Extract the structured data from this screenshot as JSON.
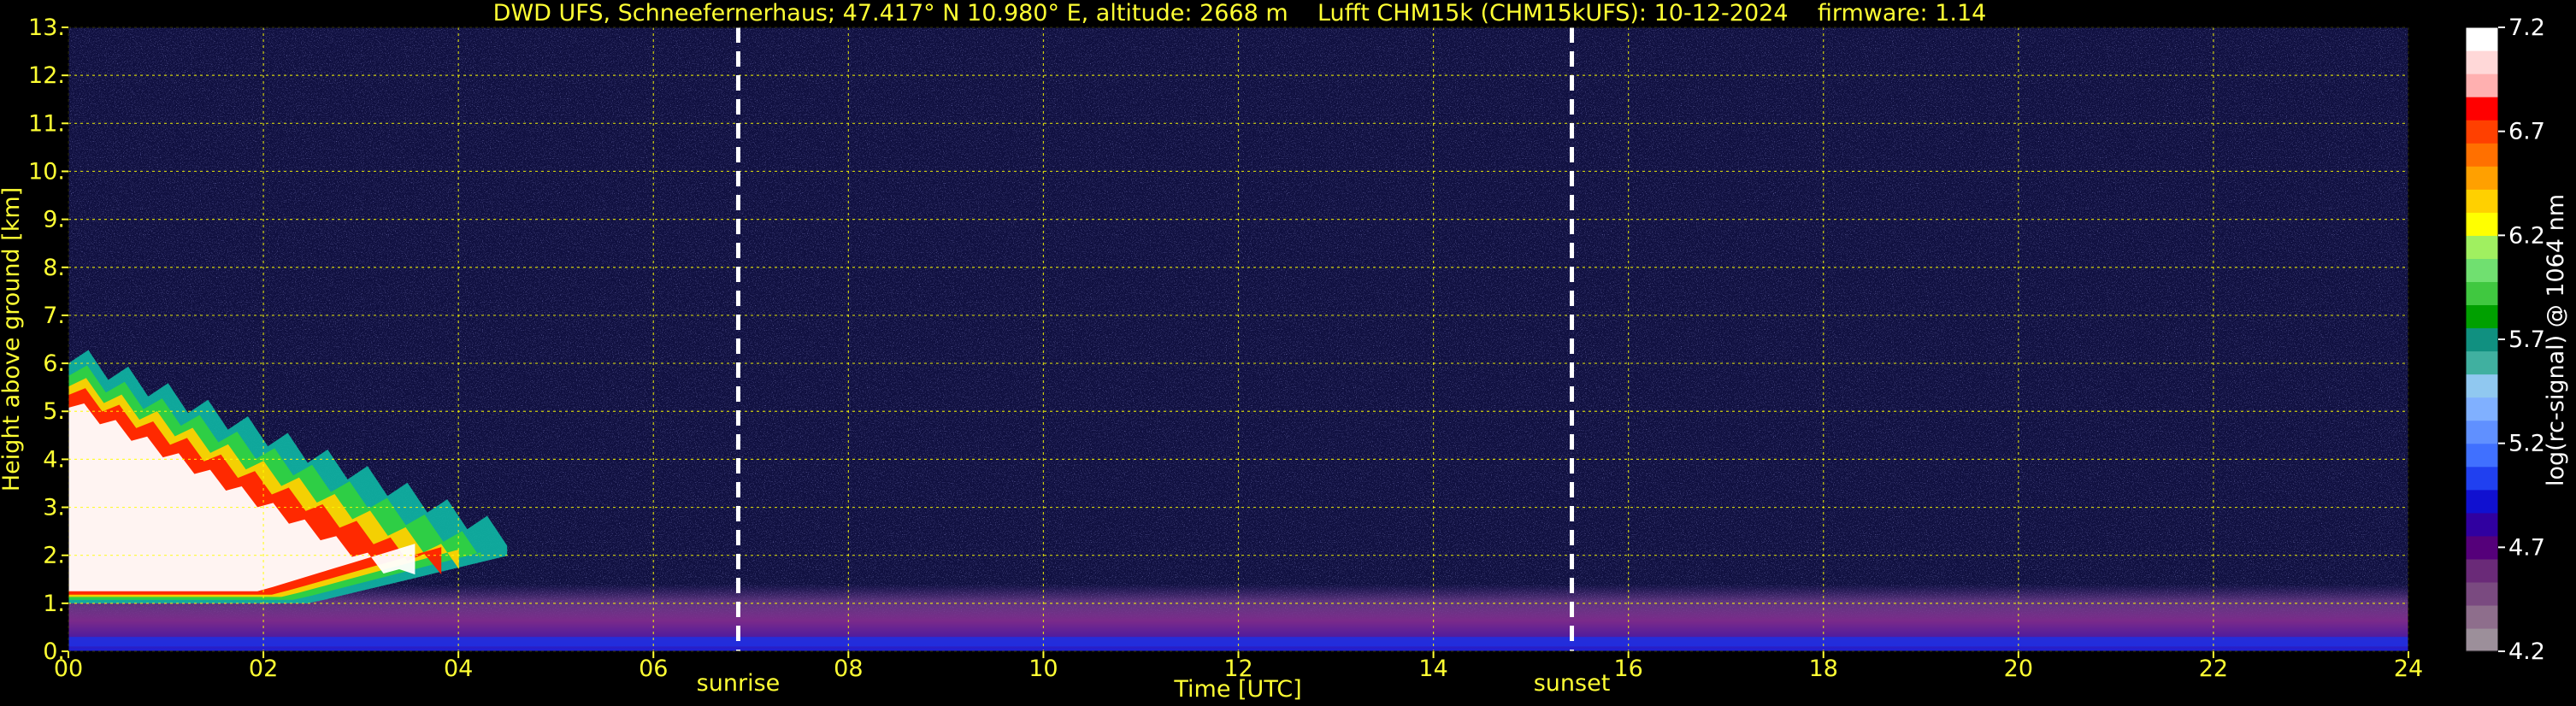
{
  "chart_data": {
    "type": "heatmap",
    "title": "DWD UFS, Schneefernerhaus; 47.417° N 10.980° E, altitude: 2668 m    Lufft CHM15k (CHM15kUFS): 10-12-2024    firmware: 1.14",
    "xlabel": "Time [UTC]",
    "ylabel": "Height above ground [km]",
    "xlim": [
      0,
      24
    ],
    "ylim": [
      0,
      13
    ],
    "x_ticks": [
      0,
      2,
      4,
      6,
      8,
      10,
      12,
      14,
      16,
      18,
      20,
      22,
      24
    ],
    "x_tick_labels": [
      "00",
      "02",
      "04",
      "06",
      "08",
      "10",
      "12",
      "14",
      "16",
      "18",
      "20",
      "22",
      "24"
    ],
    "y_ticks": [
      0,
      1,
      2,
      3,
      4,
      5,
      6,
      7,
      8,
      9,
      10,
      11,
      12,
      13
    ],
    "y_tick_labels": [
      "0.",
      "1.",
      "2.",
      "3.",
      "4.",
      "5.",
      "6.",
      "7.",
      "8.",
      "9.",
      "10.",
      "11.",
      "12.",
      "13."
    ],
    "grid": true,
    "markers": [
      {
        "label": "sunrise",
        "x": 6.87
      },
      {
        "label": "sunset",
        "x": 15.42
      }
    ],
    "colorbar": {
      "label": "log(rc-signal) @ 1064 nm",
      "range": [
        4.2,
        7.2
      ],
      "ticks": [
        4.2,
        4.7,
        5.2,
        5.7,
        6.2,
        6.7,
        7.2
      ],
      "tick_labels": [
        "4.2",
        "4.7",
        "5.2",
        "5.7",
        "6.2",
        "6.7",
        "7.2"
      ],
      "colors": [
        "#9c8f9a",
        "#8e6e8c",
        "#7a4a80",
        "#6a2a78",
        "#55007a",
        "#3000a0",
        "#1010d0",
        "#2040f0",
        "#4070ff",
        "#6090ff",
        "#80b0ff",
        "#90c8f0",
        "#40b0a0",
        "#109080",
        "#00a000",
        "#40c840",
        "#70e070",
        "#a0f060",
        "#ffff00",
        "#ffd000",
        "#ffa000",
        "#ff7000",
        "#ff4000",
        "#ff0000",
        "#ffb0b0",
        "#ffd8d8",
        "#ffffff"
      ]
    },
    "features": [
      {
        "kind": "cloud-layer",
        "x_range": [
          0.0,
          4.5
        ],
        "height_range_km": [
          1.0,
          6.0
        ],
        "peak_value": 7.2
      },
      {
        "kind": "boundary-layer",
        "x_range": [
          0.0,
          24.0
        ],
        "height_range_km": [
          0.0,
          1.4
        ],
        "value": 4.8
      },
      {
        "kind": "surface-signal",
        "x_range": [
          0.0,
          24.0
        ],
        "height_range_km": [
          0.0,
          0.3
        ],
        "value": 5.0
      },
      {
        "kind": "background-noise",
        "x_range": [
          0.0,
          24.0
        ],
        "height_range_km": [
          1.4,
          13.0
        ],
        "value": 4.5
      }
    ]
  }
}
